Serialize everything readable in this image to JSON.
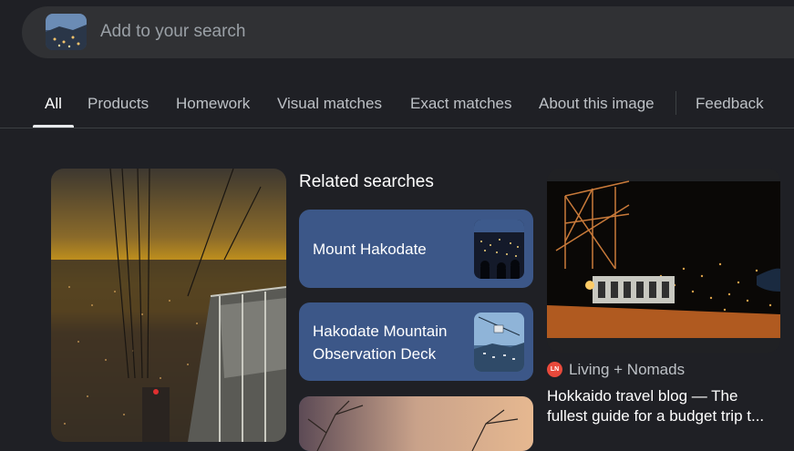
{
  "search": {
    "placeholder": "Add to your search",
    "thumbnail_icon": "city-night-thumbnail"
  },
  "tabs": [
    {
      "label": "All",
      "active": true
    },
    {
      "label": "Products"
    },
    {
      "label": "Homework"
    },
    {
      "label": "Visual matches"
    },
    {
      "label": "Exact matches"
    },
    {
      "label": "About this image"
    },
    {
      "label": "Feedback"
    }
  ],
  "related": {
    "title": "Related searches",
    "items": [
      {
        "label": "Mount Hakodate"
      },
      {
        "label_line1": "Hakodate Mountain",
        "label_line2": "Observation Deck"
      },
      {
        "label": ""
      }
    ]
  },
  "result": {
    "source": "Living + Nomads",
    "source_icon": "LN",
    "title": "Hokkaido travel blog — The fullest guide for a budget trip t..."
  },
  "colors": {
    "background": "#1f2025",
    "card": "#3c5788",
    "search_bar": "#303134"
  }
}
